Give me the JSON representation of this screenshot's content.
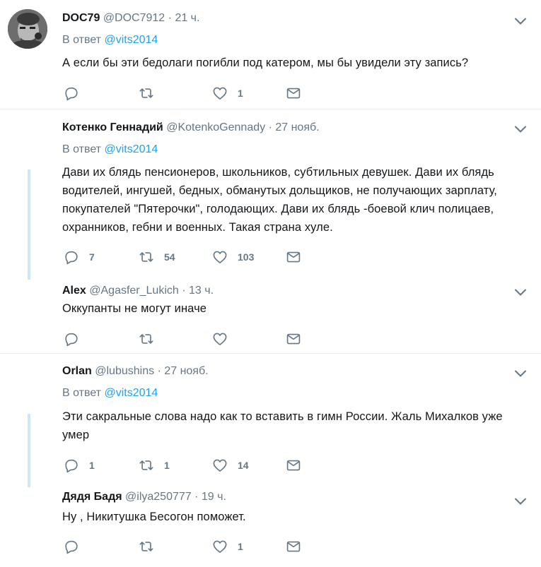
{
  "tweets": [
    {
      "fullname": "DOC79",
      "username": "@DOC7912",
      "time": "21 ч.",
      "reply_prefix": "В ответ",
      "reply_mention": "@vits2014",
      "text": "А если бы эти бедолаги погибли под катером, мы бы увидели эту запись?",
      "replies": "",
      "retweets": "",
      "likes": "1"
    },
    {
      "fullname": "Котенко Геннадий",
      "username": "@KotenkoGennady",
      "time": "27 нояб.",
      "reply_prefix": "В ответ",
      "reply_mention": "@vits2014",
      "text": "Дави их блядь пенсионеров, школьников, субтильных девушек. Дави их блядь водителей, ингушей, бедных, обманутых дольщиков, не получающих зарплату, покупателей \"Пятерочки\", голодающих. Дави их блядь -боевой клич полицаев, охранников, гебни и военных. Такая страна хуле.",
      "replies": "7",
      "retweets": "54",
      "likes": "103"
    },
    {
      "fullname": "Alex",
      "username": "@Agasfer_Lukich",
      "time": "13 ч.",
      "text": "Оккупанты не могут иначе",
      "replies": "",
      "retweets": "",
      "likes": ""
    },
    {
      "fullname": "Orlan",
      "username": "@lubushins",
      "time": "27 нояб.",
      "reply_prefix": "В ответ",
      "reply_mention": "@vits2014",
      "text": "Эти сакральные слова надо как то вставить в гимн России. Жаль Михалков уже умер",
      "replies": "1",
      "retweets": "1",
      "likes": "14"
    },
    {
      "fullname": "Дядя Бадя",
      "username": "@ilya250777",
      "time": "19 ч.",
      "text": "Ну , Никитушка Бесогон поможет.",
      "replies": "",
      "retweets": "",
      "likes": "1"
    }
  ],
  "colors": {
    "link": "#1da1f2",
    "meta": "#657786",
    "thread_line": "#cce7f9",
    "divider": "#e6ecf0"
  },
  "icons": [
    "reply-icon",
    "retweet-icon",
    "like-icon",
    "direct-message-icon",
    "caret-down-icon"
  ]
}
